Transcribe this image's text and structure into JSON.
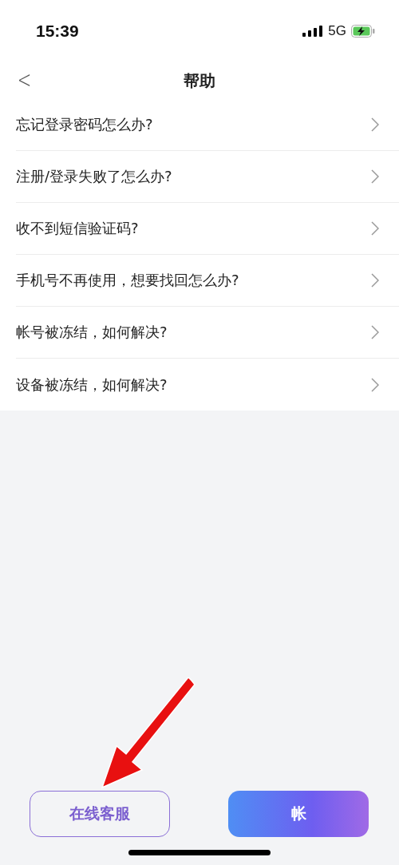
{
  "status_bar": {
    "time": "15:39",
    "network": "5G"
  },
  "header": {
    "back": "<",
    "title": "帮助"
  },
  "items": [
    {
      "label": "忘记登录密码怎么办?"
    },
    {
      "label": "注册/登录失败了怎么办?"
    },
    {
      "label": "收不到短信验证码?"
    },
    {
      "label": "手机号不再使用，想要找回怎么办?"
    },
    {
      "label": "帐号被冻结，如何解决?"
    },
    {
      "label": "设备被冻结，如何解决?"
    }
  ],
  "buttons": [
    {
      "label": "在线客服",
      "kind": "outline"
    },
    {
      "label": "帐",
      "kind": "gradient"
    }
  ]
}
